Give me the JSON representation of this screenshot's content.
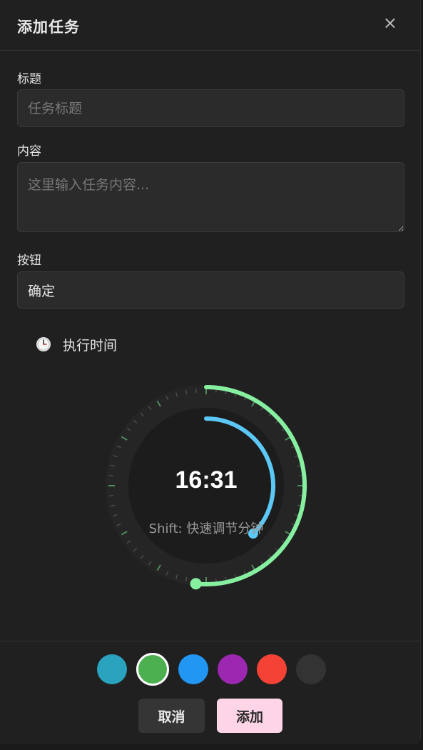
{
  "dialog": {
    "title": "添加任务",
    "close_symbol": "×"
  },
  "form": {
    "title_label": "标题",
    "title_placeholder": "任务标题",
    "title_value": "",
    "content_label": "内容",
    "content_placeholder": "这里输入任务内容...",
    "content_value": "",
    "button_label": "按钮",
    "button_value": "确定"
  },
  "schedule": {
    "icon": "clock-icon",
    "label": "执行时间",
    "time": "16:31",
    "hour": 16,
    "minute": 31,
    "hint": "Shift: 快速调节分钟"
  },
  "colors": {
    "options": [
      "#2aa3bf",
      "#4caf50",
      "#2196f3",
      "#9c27b0",
      "#f44336",
      "#333333"
    ],
    "selected_index": 1,
    "minute_ring": "#86efa0",
    "hour_ring": "#5cc8f5"
  },
  "footer": {
    "cancel_label": "取消",
    "add_label": "添加"
  }
}
